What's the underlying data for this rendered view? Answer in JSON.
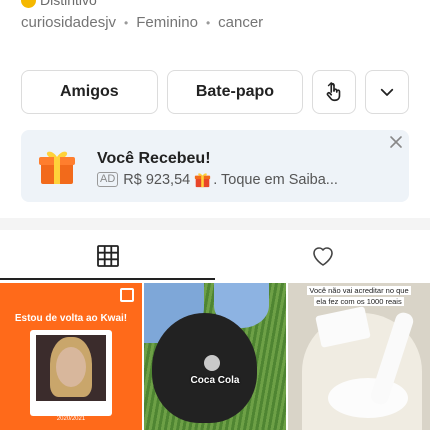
{
  "profile": {
    "badge_label": "Distintivo",
    "username": "curiosidadesjv",
    "gender": "Feminino",
    "sign": "cancer"
  },
  "actions": {
    "friends_label": "Amigos",
    "chat_label": "Bate-papo",
    "share_icon": "share-hand-icon",
    "more_icon": "chevron-down-icon"
  },
  "promo": {
    "title": "Você Recebeu!",
    "ad_label": "AD",
    "amount": "R$ 923,54",
    "cta": ". Toque em Saiba..."
  },
  "tabs": [
    {
      "name": "grid",
      "icon": "grid-icon",
      "active": true
    },
    {
      "name": "likes",
      "icon": "heart-icon",
      "active": false
    }
  ],
  "posts": [
    {
      "title": "Estou de volta ao Kwai!",
      "handle": "@Curiosidades",
      "date": "2020/2021"
    },
    {
      "caption": "Coca Cola"
    },
    {
      "caption_line1": "Você não vai acreditar no que",
      "caption_line2": "ela fez com os 1000 reais"
    }
  ],
  "colors": {
    "accent_orange": "#ff6a1a",
    "promo_bg": "#eef3f8"
  }
}
